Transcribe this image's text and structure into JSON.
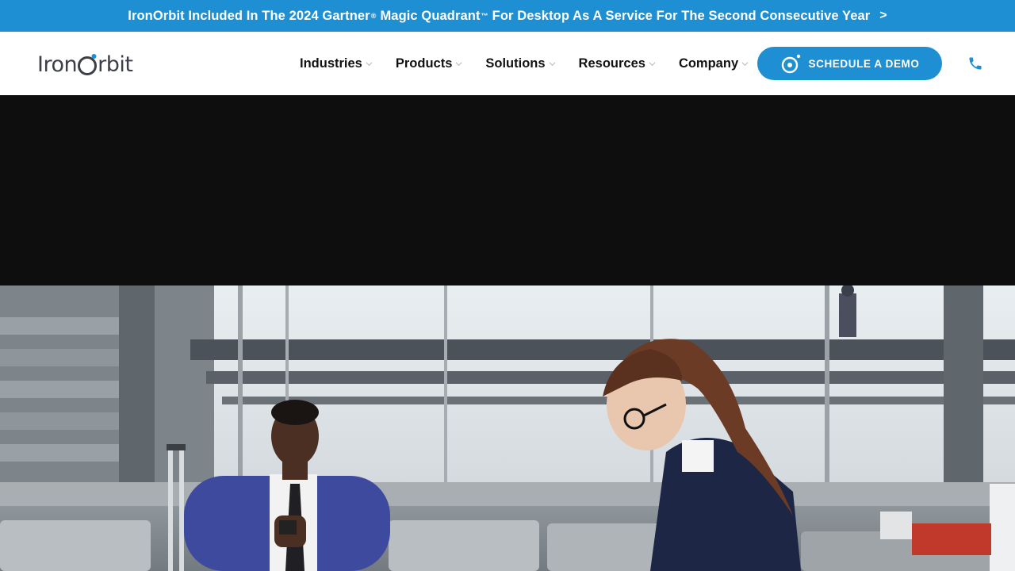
{
  "announcement": {
    "part1": "IronOrbit Included In The 2024 Gartner",
    "reg": "®",
    "part2": "Magic Quadrant",
    "tm": "™",
    "part3": "For Desktop As A Service For The Second Consecutive Year",
    "arrow": ">"
  },
  "logo": {
    "text_prefix": "Iron",
    "text_suffix": "rbit"
  },
  "menu": {
    "items": [
      {
        "label": "Industries"
      },
      {
        "label": "Products"
      },
      {
        "label": "Solutions"
      },
      {
        "label": "Resources"
      },
      {
        "label": "Company"
      }
    ]
  },
  "cta": {
    "label": "SCHEDULE A DEMO"
  },
  "icons": {
    "chevron": "chevron-down-icon",
    "phone": "phone-icon",
    "orbit": "orbit-icon"
  },
  "colors": {
    "brand_blue": "#1f8fd3",
    "text_dark": "#111111",
    "video_bg": "#0e0e0f"
  }
}
